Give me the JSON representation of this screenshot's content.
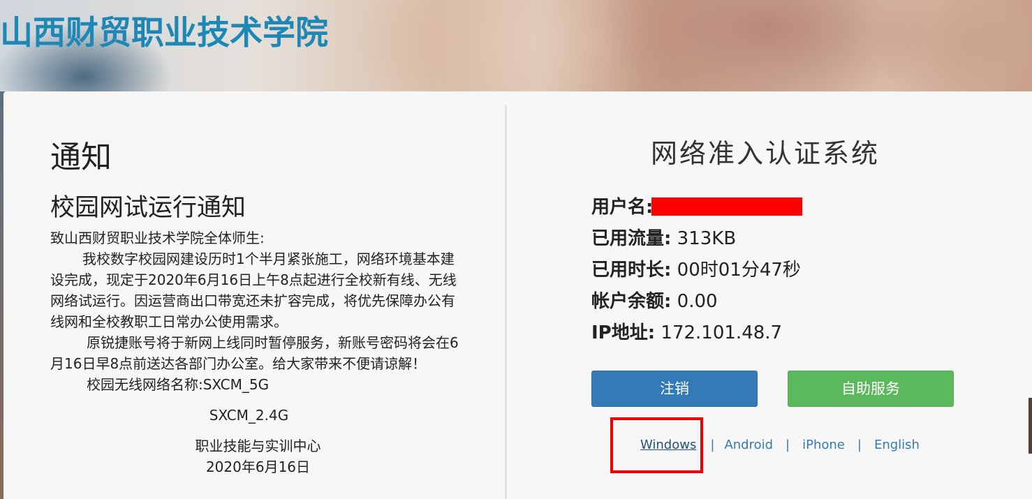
{
  "header": {
    "school_name": "山西财贸职业技术学院"
  },
  "notice": {
    "heading": "通知",
    "title": "校园网试运行通知",
    "greeting": "致山西财贸职业技术学院全体师生:",
    "paragraph1": "我校数字校园网建设历时1个半月紧张施工，网络环境基本建设完成，现定于2020年6月16日上午8点起进行全校新有线、无线网络试运行。因运营商出口带宽还未扩容完成，将优先保障办公有线网和全校教职工日常办公使用需求。",
    "paragraph2": "原锐捷账号将于新网上线同时暂停服务，新账号密码将会在6月16日早8点前送达各部门办公室。给大家带来不便请谅解！",
    "wifi_line": "校园无线网络名称:SXCM_5G",
    "wifi_line2": "SXCM_2.4G",
    "signature": "职业技能与实训中心",
    "date": "2020年6月16日"
  },
  "auth": {
    "system_title": "网络准入认证系统",
    "username_label": "用户名:",
    "traffic_label": "已用流量:",
    "traffic_value": "313KB",
    "duration_label": "已用时长:",
    "duration_value": "00时01分47秒",
    "balance_label": "帐户余额:",
    "balance_value": "0.00",
    "ip_label": "IP地址:",
    "ip_value": "172.101.48.7",
    "logout_button": "注销",
    "service_button": "自助服务"
  },
  "client_links": {
    "windows": "Windows",
    "android": "Android",
    "iphone": "iPhone",
    "english": "English",
    "separator": "|"
  },
  "colors": {
    "school_title": "#1d87b5",
    "primary_button": "#337ab7",
    "success_button": "#5cb85c",
    "highlight_border": "#ee0000",
    "redaction": "#ff0000"
  }
}
